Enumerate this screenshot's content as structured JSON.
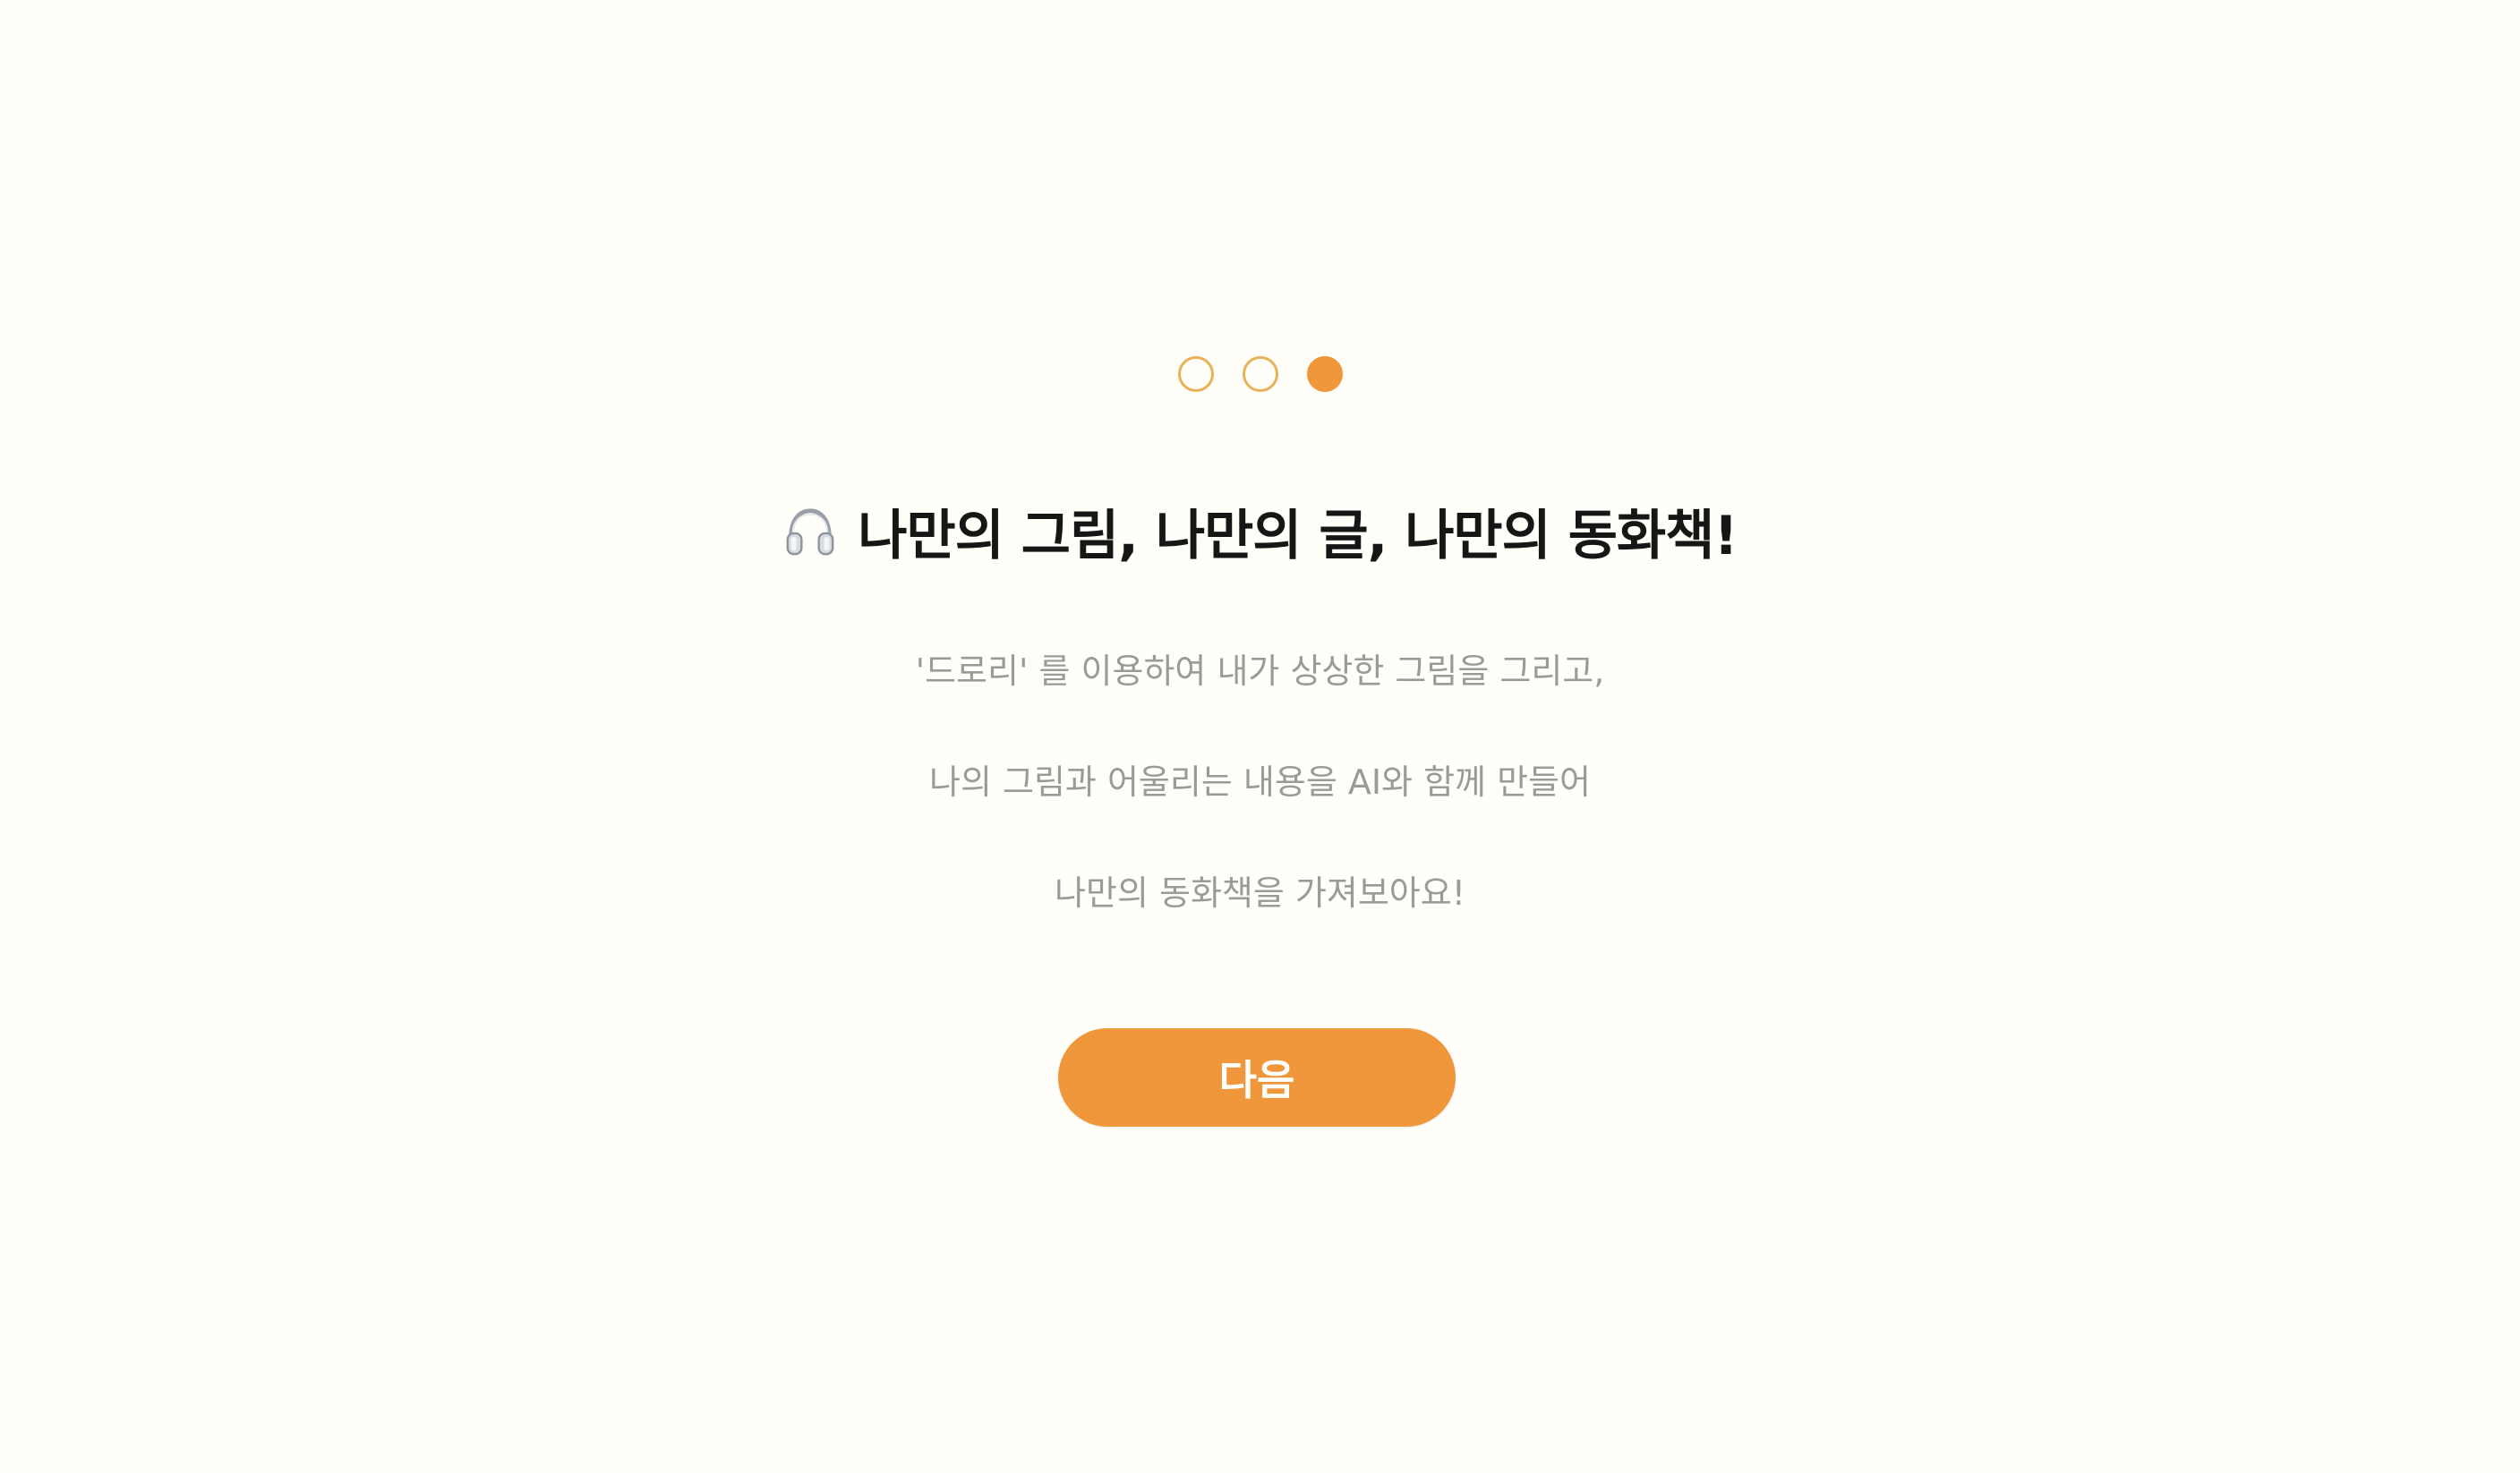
{
  "pagination": {
    "total": 3,
    "current": 3
  },
  "title": {
    "icon": "headphones-icon",
    "text": "나만의 그림, 나만의 글, 나만의 동화책!"
  },
  "description": {
    "line1": "'드로리' 를 이용하여 내가 상상한 그림을 그리고,",
    "line2": "나의 그림과 어울리는 내용을 AI와 함께 만들어",
    "line3": "나만의 동화책을 가져보아요!"
  },
  "next_button": {
    "label": "다음"
  },
  "colors": {
    "accent": "#ef973a",
    "dot_outline": "#e9b258",
    "background": "#fffef8",
    "title": "#161616",
    "description": "#9a9a9a"
  }
}
